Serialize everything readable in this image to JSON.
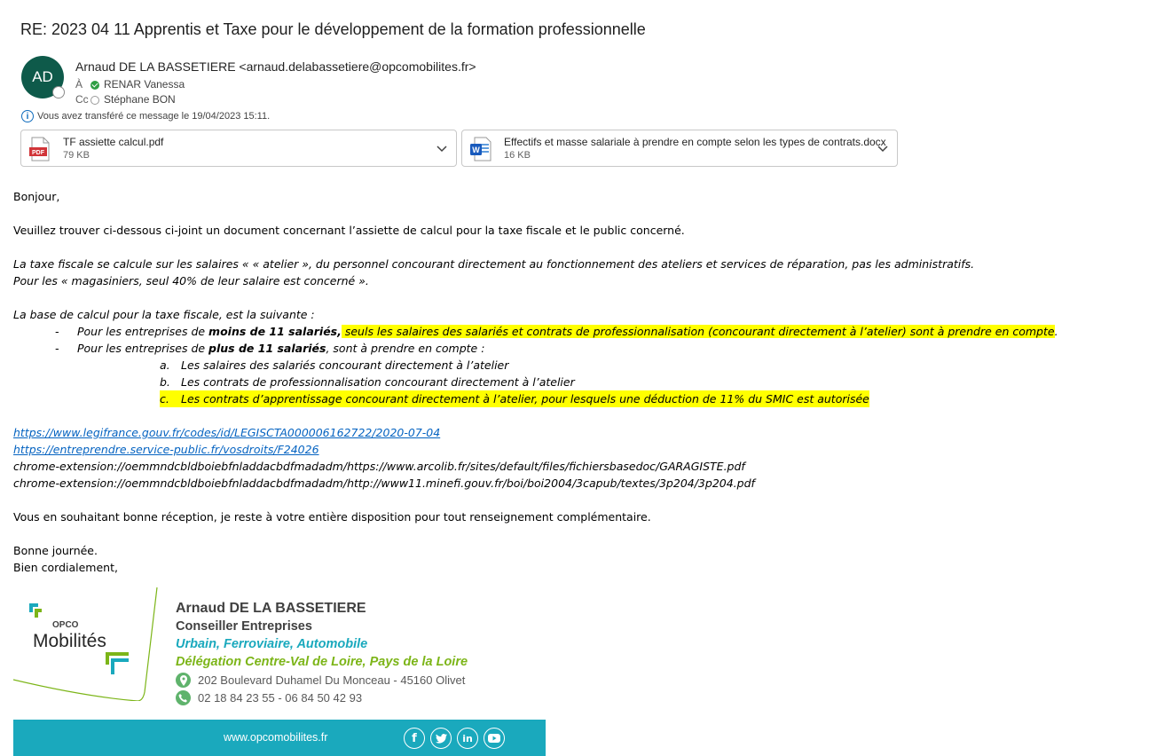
{
  "email": {
    "subject": "RE: 2023 04 11 Apprentis et Taxe pour le développement de la formation professionnelle",
    "avatar_initials": "AD",
    "sender": "Arnaud DE LA BASSETIERE <arnaud.delabassetiere@opcomobilites.fr>",
    "to_label": "À",
    "to_name": "RENAR Vanessa",
    "cc_label": "Cc",
    "cc_name": "Stéphane BON",
    "info_text": "Vous avez transféré ce message le 19/04/2023 15:11."
  },
  "attachments": [
    {
      "name": "TF assiette calcul.pdf",
      "size": "79 KB",
      "type": "pdf"
    },
    {
      "name": "Effectifs et masse salariale à prendre en compte selon les types de contrats.docx",
      "size": "16 KB",
      "type": "docx"
    }
  ],
  "body": {
    "greeting": "Bonjour,",
    "intro": "Veuillez trouver ci-dessous ci-joint un document concernant l’assiette de calcul pour la taxe fiscale et le public concerné.",
    "para1_line1": "La taxe fiscale se calcule sur les salaires « « atelier », du personnel concourant directement au fonctionnement des ateliers et services de réparation, pas les administratifs.",
    "para1_line2": "Pour les « magasiniers, seul 40% de leur salaire est concerné ».",
    "base_intro": "La base de calcul pour la taxe fiscale, est la suivante :",
    "bullet_dash": "-",
    "bullet1_a": "Pour les entreprises de ",
    "bullet1_b": "moins de 11 salariés,",
    "bullet1_hl": " seuls les salaires des salariés et contrats de professionnalisation (concourant directement à l’atelier) sont à prendre en compte",
    "bullet1_end": ".",
    "bullet2_a": "Pour les entreprises de ",
    "bullet2_b": "plus de 11 salariés",
    "bullet2_c": ", sont à prendre en compte :",
    "sub_items": [
      {
        "letter": "a.",
        "text": "Les salaires des salariés concourant directement à l’atelier"
      },
      {
        "letter": "b.",
        "text": "Les contrats de professionnalisation concourant directement à l’atelier"
      },
      {
        "letter": "c.",
        "text": "Les contrats d’apprentissage concourant directement à l’atelier, pour lesquels une déduction de 11% du SMIC est autorisée"
      }
    ],
    "link1": "https://www.legifrance.gouv.fr/codes/id/LEGISCTA000006162722/2020-07-04",
    "link2": "https://entreprendre.service-public.fr/vosdroits/F24026",
    "ext1": "chrome-extension://oemmndcbldboiebfnladdacbdfmadadm/https://www.arcolib.fr/sites/default/files/fichiersbasedoc/GARAGISTE.pdf",
    "ext2": "chrome-extension://oemmndcbldboiebfnladdacbdfmadadm/http://www11.minefi.gouv.fr/boi/boi2004/3capub/textes/3p204/3p204.pdf",
    "closing1": "Vous en souhaitant bonne réception, je reste à votre entière disposition pour tout renseignement complémentaire.",
    "closing2": "Bonne journée.",
    "closing3": "Bien cordialement,"
  },
  "signature": {
    "logo_small": "OPCO",
    "logo_big": "Mobilités",
    "name": "Arnaud DE LA BASSETIERE",
    "role": "Conseiller Entreprises",
    "dept": "Urbain, Ferroviaire, Automobile",
    "delegation": "Délégation Centre-Val de Loire, Pays de la Loire",
    "address": "202 Boulevard Duhamel Du Monceau - 45160 Olivet",
    "phone": "02 18 84 23 55 - 06 84 50 42 93",
    "website": "www.opcomobilites.fr",
    "social": {
      "facebook": "f",
      "linkedin": "in"
    }
  },
  "colors": {
    "avatar": "#0e5a4a",
    "highlight": "#ffff00",
    "link": "#0563c1",
    "teal": "#1aa9bd",
    "green": "#7cb518"
  }
}
